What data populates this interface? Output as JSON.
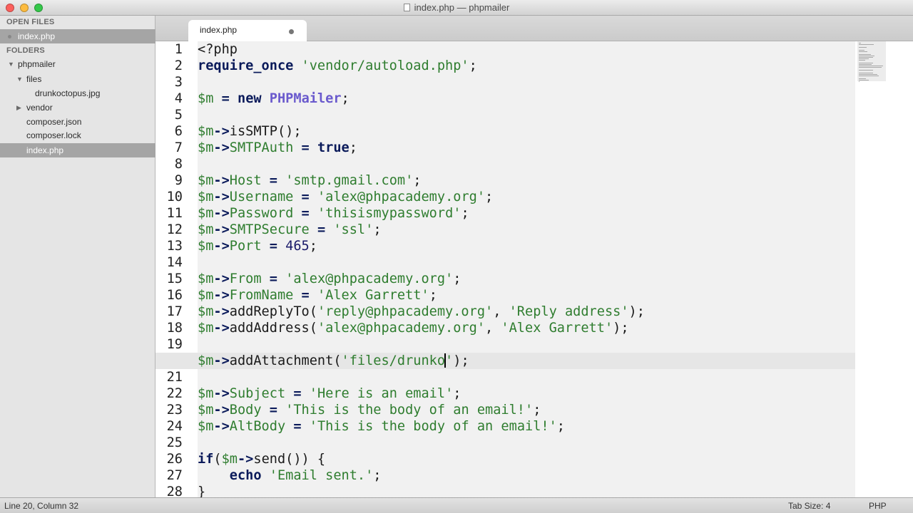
{
  "window": {
    "title": "index.php — phpmailer"
  },
  "sidebar": {
    "open_files_header": "OPEN FILES",
    "open_files": [
      "index.php"
    ],
    "folders_header": "FOLDERS",
    "tree": [
      {
        "label": "phpmailer",
        "expanded": true
      },
      {
        "label": "files",
        "expanded": true
      },
      {
        "label": "drunkoctopus.jpg"
      },
      {
        "label": "vendor",
        "expanded": false
      },
      {
        "label": "composer.json"
      },
      {
        "label": "composer.lock"
      },
      {
        "label": "index.php",
        "selected": true
      }
    ]
  },
  "tab": {
    "label": "index.php"
  },
  "editor": {
    "current_line": 20,
    "line_numbers": [
      "1",
      "2",
      "3",
      "4",
      "5",
      "6",
      "7",
      "8",
      "9",
      "10",
      "11",
      "12",
      "13",
      "14",
      "15",
      "16",
      "17",
      "18",
      "19",
      "20",
      "21",
      "22",
      "23",
      "24",
      "25",
      "26",
      "27",
      "28"
    ],
    "lines": [
      [
        [
          "kw-plain",
          "<?php"
        ]
      ],
      [
        [
          "kw",
          "require_once"
        ],
        [
          "p",
          " "
        ],
        [
          "str",
          "'vendor/autoload.php'"
        ],
        [
          "p",
          ";"
        ]
      ],
      [],
      [
        [
          "var",
          "$m"
        ],
        [
          "p",
          " "
        ],
        [
          "op",
          "="
        ],
        [
          "p",
          " "
        ],
        [
          "kw",
          "new"
        ],
        [
          "p",
          " "
        ],
        [
          "cls",
          "PHPMailer"
        ],
        [
          "p",
          ";"
        ]
      ],
      [],
      [
        [
          "var",
          "$m"
        ],
        [
          "op",
          "->"
        ],
        [
          "fn",
          "isSMTP"
        ],
        [
          "p",
          "();"
        ]
      ],
      [
        [
          "var",
          "$m"
        ],
        [
          "op",
          "->"
        ],
        [
          "var",
          "SMTPAuth"
        ],
        [
          "p",
          " "
        ],
        [
          "op",
          "="
        ],
        [
          "p",
          " "
        ],
        [
          "kw",
          "true"
        ],
        [
          "p",
          ";"
        ]
      ],
      [],
      [
        [
          "var",
          "$m"
        ],
        [
          "op",
          "->"
        ],
        [
          "var",
          "Host"
        ],
        [
          "p",
          " "
        ],
        [
          "op",
          "="
        ],
        [
          "p",
          " "
        ],
        [
          "str",
          "'smtp.gmail.com'"
        ],
        [
          "p",
          ";"
        ]
      ],
      [
        [
          "var",
          "$m"
        ],
        [
          "op",
          "->"
        ],
        [
          "var",
          "Username"
        ],
        [
          "p",
          " "
        ],
        [
          "op",
          "="
        ],
        [
          "p",
          " "
        ],
        [
          "str",
          "'alex@phpacademy.org'"
        ],
        [
          "p",
          ";"
        ]
      ],
      [
        [
          "var",
          "$m"
        ],
        [
          "op",
          "->"
        ],
        [
          "var",
          "Password"
        ],
        [
          "p",
          " "
        ],
        [
          "op",
          "="
        ],
        [
          "p",
          " "
        ],
        [
          "str",
          "'thisismypassword'"
        ],
        [
          "p",
          ";"
        ]
      ],
      [
        [
          "var",
          "$m"
        ],
        [
          "op",
          "->"
        ],
        [
          "var",
          "SMTPSecure"
        ],
        [
          "p",
          " "
        ],
        [
          "op",
          "="
        ],
        [
          "p",
          " "
        ],
        [
          "str",
          "'ssl'"
        ],
        [
          "p",
          ";"
        ]
      ],
      [
        [
          "var",
          "$m"
        ],
        [
          "op",
          "->"
        ],
        [
          "var",
          "Port"
        ],
        [
          "p",
          " "
        ],
        [
          "op",
          "="
        ],
        [
          "p",
          " "
        ],
        [
          "num",
          "465"
        ],
        [
          "p",
          ";"
        ]
      ],
      [],
      [
        [
          "var",
          "$m"
        ],
        [
          "op",
          "->"
        ],
        [
          "var",
          "From"
        ],
        [
          "p",
          " "
        ],
        [
          "op",
          "="
        ],
        [
          "p",
          " "
        ],
        [
          "str",
          "'alex@phpacademy.org'"
        ],
        [
          "p",
          ";"
        ]
      ],
      [
        [
          "var",
          "$m"
        ],
        [
          "op",
          "->"
        ],
        [
          "var",
          "FromName"
        ],
        [
          "p",
          " "
        ],
        [
          "op",
          "="
        ],
        [
          "p",
          " "
        ],
        [
          "str",
          "'Alex Garrett'"
        ],
        [
          "p",
          ";"
        ]
      ],
      [
        [
          "var",
          "$m"
        ],
        [
          "op",
          "->"
        ],
        [
          "fn",
          "addReplyTo"
        ],
        [
          "p",
          "("
        ],
        [
          "str",
          "'reply@phpacademy.org'"
        ],
        [
          "p",
          ", "
        ],
        [
          "str",
          "'Reply address'"
        ],
        [
          "p",
          ");"
        ]
      ],
      [
        [
          "var",
          "$m"
        ],
        [
          "op",
          "->"
        ],
        [
          "fn",
          "addAddress"
        ],
        [
          "p",
          "("
        ],
        [
          "str",
          "'alex@phpacademy.org'"
        ],
        [
          "p",
          ", "
        ],
        [
          "str",
          "'Alex Garrett'"
        ],
        [
          "p",
          ");"
        ]
      ],
      [],
      [
        [
          "var",
          "$m"
        ],
        [
          "op",
          "->"
        ],
        [
          "fn",
          "addAttachment"
        ],
        [
          "p",
          "("
        ],
        [
          "str",
          "'files/drunko"
        ],
        [
          "caret",
          ""
        ],
        [
          "str",
          "'"
        ],
        [
          "p",
          ");"
        ]
      ],
      [],
      [
        [
          "var",
          "$m"
        ],
        [
          "op",
          "->"
        ],
        [
          "var",
          "Subject"
        ],
        [
          "p",
          " "
        ],
        [
          "op",
          "="
        ],
        [
          "p",
          " "
        ],
        [
          "str",
          "'Here is an email'"
        ],
        [
          "p",
          ";"
        ]
      ],
      [
        [
          "var",
          "$m"
        ],
        [
          "op",
          "->"
        ],
        [
          "var",
          "Body"
        ],
        [
          "p",
          " "
        ],
        [
          "op",
          "="
        ],
        [
          "p",
          " "
        ],
        [
          "str",
          "'This is the body of an email!'"
        ],
        [
          "p",
          ";"
        ]
      ],
      [
        [
          "var",
          "$m"
        ],
        [
          "op",
          "->"
        ],
        [
          "var",
          "AltBody"
        ],
        [
          "p",
          " "
        ],
        [
          "op",
          "="
        ],
        [
          "p",
          " "
        ],
        [
          "str",
          "'This is the body of an email!'"
        ],
        [
          "p",
          ";"
        ]
      ],
      [],
      [
        [
          "kw",
          "if"
        ],
        [
          "p",
          "("
        ],
        [
          "var",
          "$m"
        ],
        [
          "op",
          "->"
        ],
        [
          "fn",
          "send"
        ],
        [
          "p",
          "()) {"
        ]
      ],
      [
        [
          "p",
          "    "
        ],
        [
          "kw",
          "echo"
        ],
        [
          "p",
          " "
        ],
        [
          "str",
          "'Email sent.'"
        ],
        [
          "p",
          ";"
        ]
      ],
      [
        [
          "p",
          "}"
        ]
      ]
    ]
  },
  "status": {
    "position": "Line 20, Column 32",
    "tab_size": "Tab Size: 4",
    "syntax": "PHP"
  }
}
